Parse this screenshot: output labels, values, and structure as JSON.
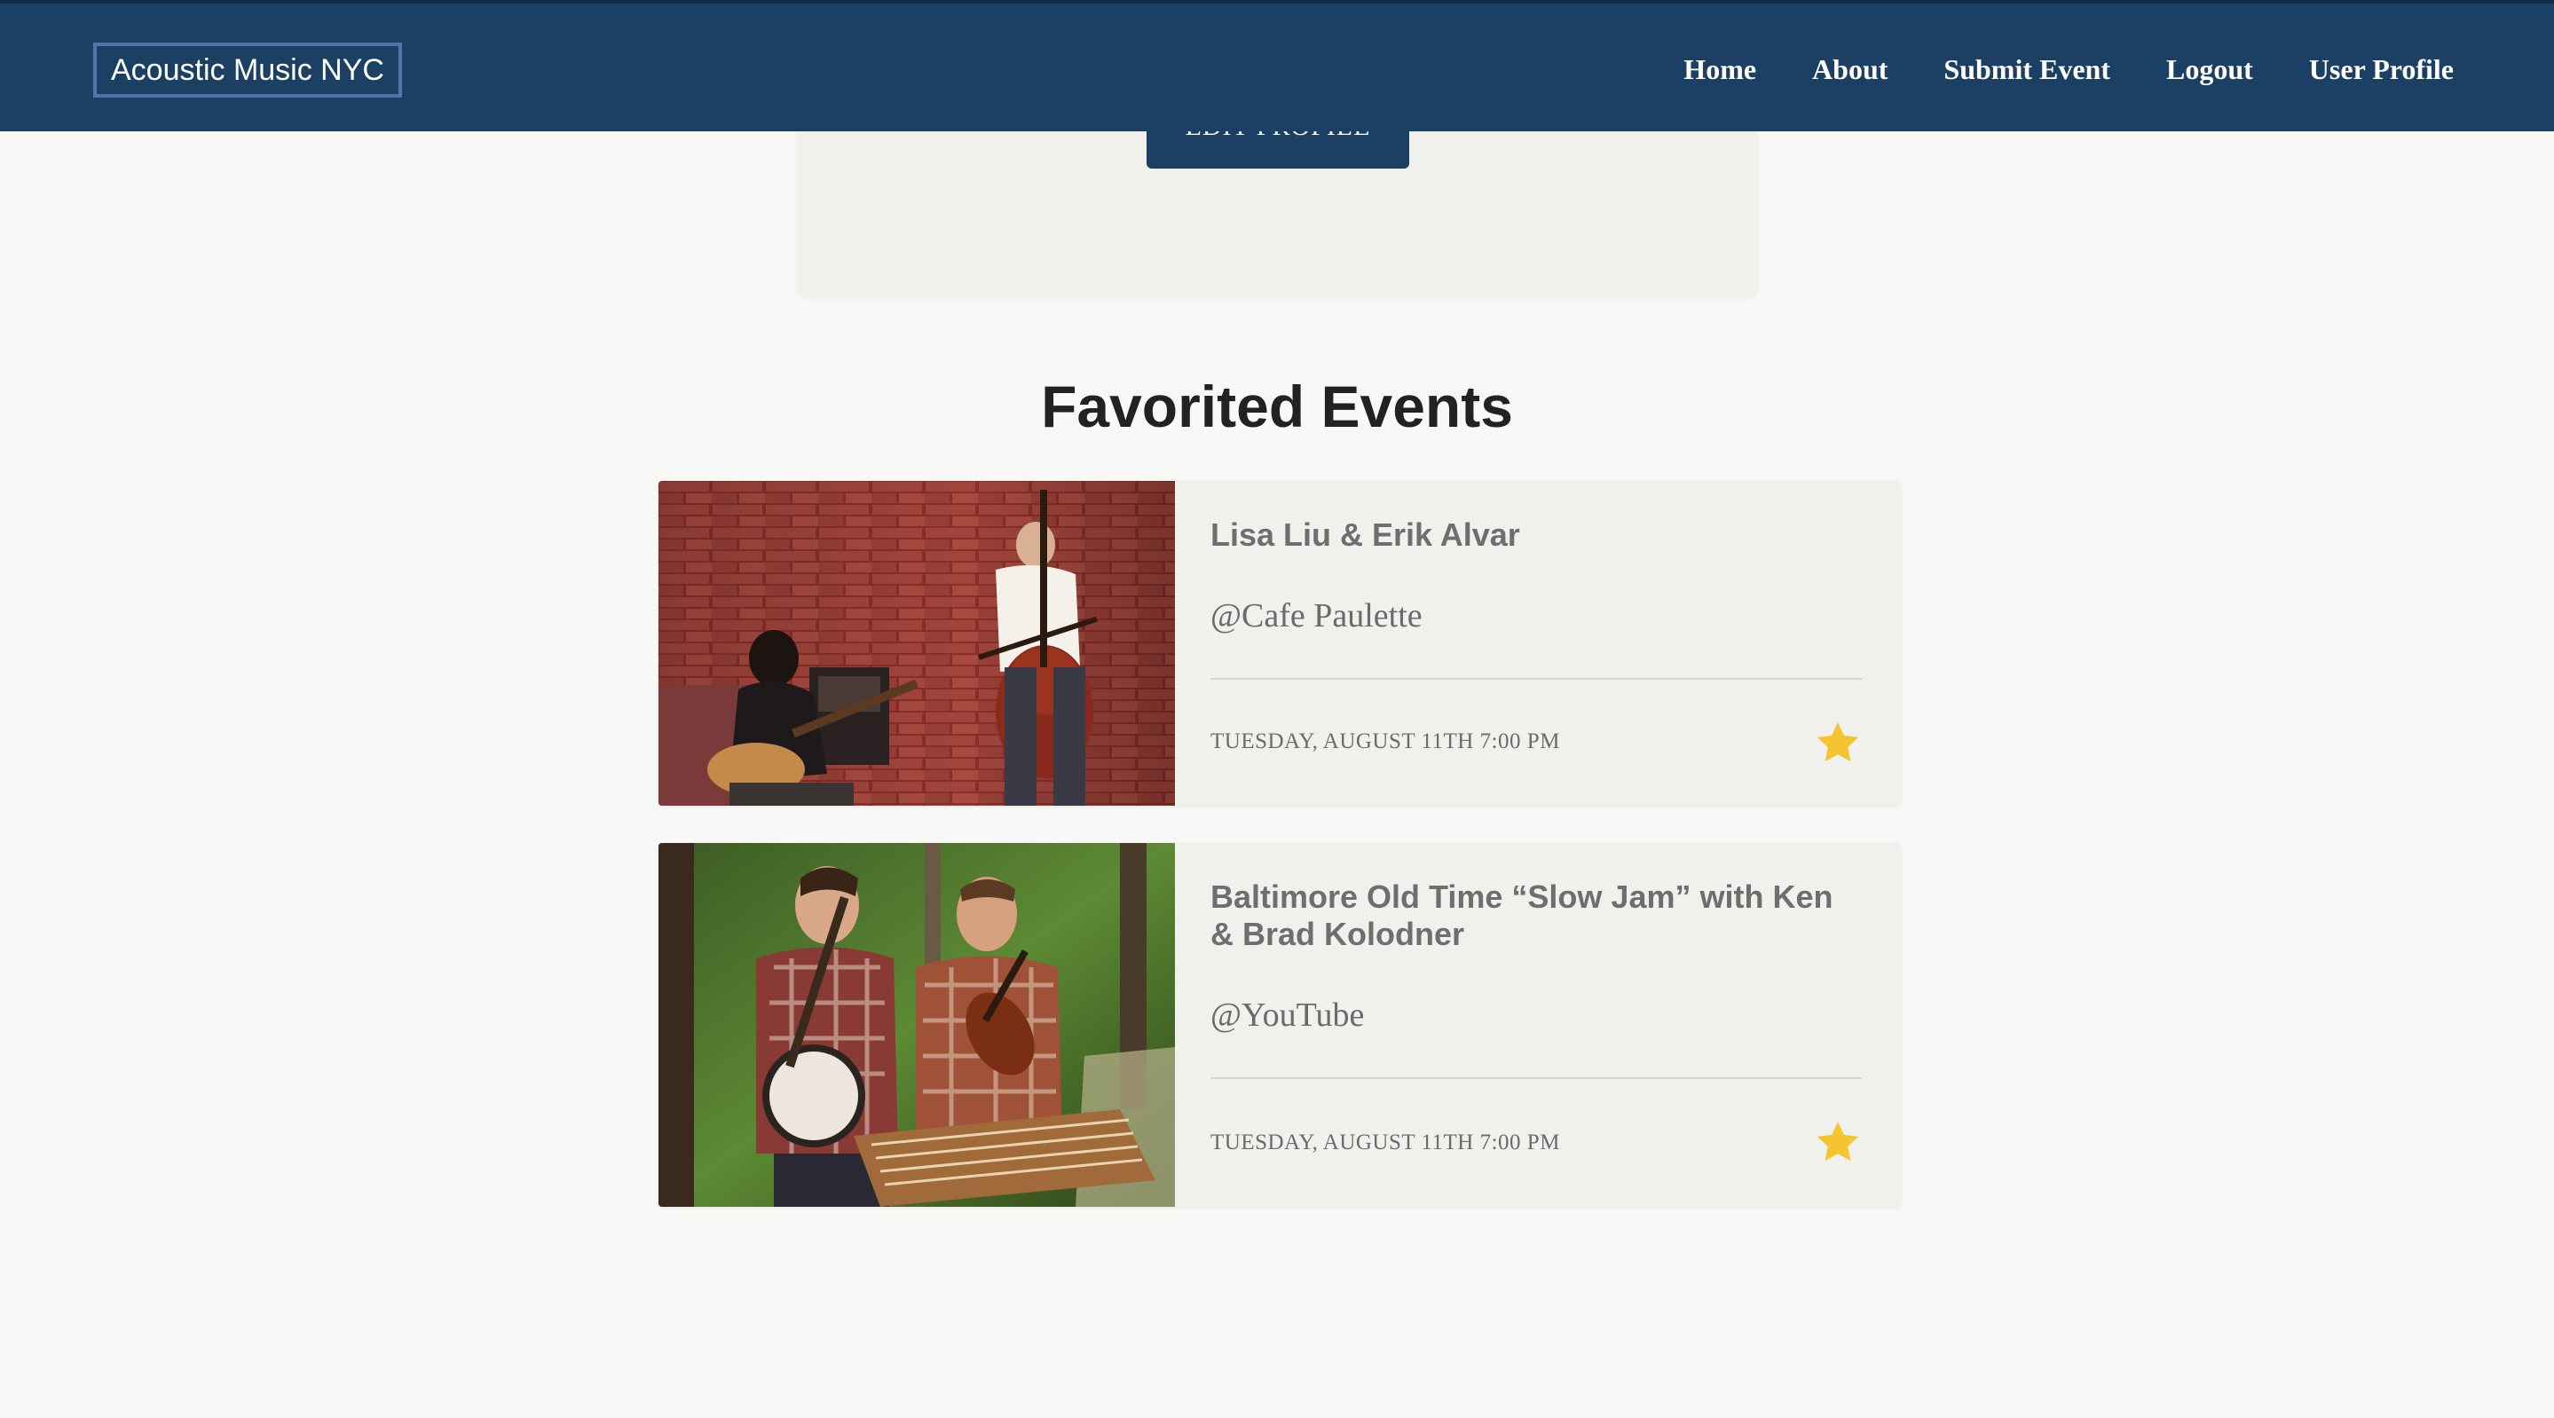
{
  "navbar": {
    "brand": "Acoustic Music NYC",
    "links": [
      "Home",
      "About",
      "Submit Event",
      "Logout",
      "User Profile"
    ]
  },
  "profile": {
    "edit_button": "EDIT PROFILE"
  },
  "favorites": {
    "title": "Favorited Events",
    "events": [
      {
        "title": "Lisa Liu & Erik Alvar",
        "venue": "@Cafe Paulette",
        "date": "TUESDAY, AUGUST 11TH 7:00 PM",
        "favorited": true,
        "image": "Guitarist and upright bass player in front of a brick wall"
      },
      {
        "title": "Baltimore Old Time “Slow Jam” with Ken & Brad Kolodner",
        "venue": "@YouTube",
        "date": "TUESDAY, AUGUST 11TH 7:00 PM",
        "favorited": true,
        "image": "Two musicians with banjo, fiddle and hammered dulcimer in a forest"
      }
    ]
  },
  "colors": {
    "navbar": "#1b4064",
    "page_bg": "#f8f8f6",
    "card_bg": "#f0f0ed",
    "star": "#f5c431"
  },
  "icons": {
    "favorite": "star-icon"
  }
}
